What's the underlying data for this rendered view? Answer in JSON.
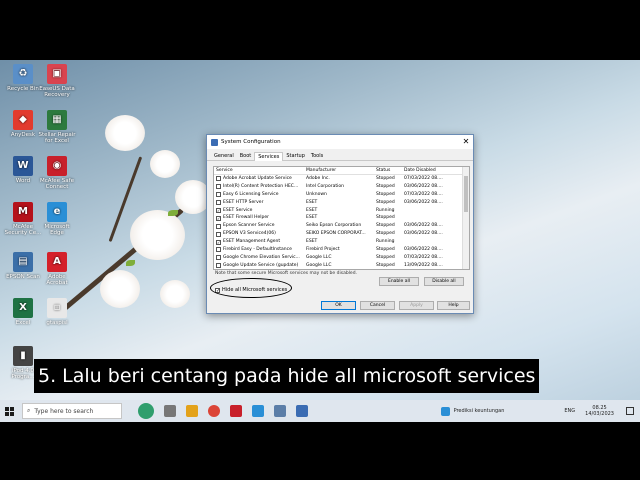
{
  "desktop": {
    "icons": [
      {
        "label": "Recycle Bin",
        "color": "#5a8fc8",
        "glyph": "♻"
      },
      {
        "label": "EaseUS Data Recovery",
        "color": "#d9444f",
        "glyph": "▣"
      },
      {
        "label": "AnyDesk",
        "color": "#e23b2e",
        "glyph": "◆"
      },
      {
        "label": "Stellar Repair for Excel",
        "color": "#2d7a3e",
        "glyph": "▦"
      },
      {
        "label": "Word",
        "color": "#2b5797",
        "glyph": "W"
      },
      {
        "label": "McAfee Safe Connect",
        "color": "#c8202b",
        "glyph": "◉"
      },
      {
        "label": "McAfee Security Ce...",
        "color": "#b5121b",
        "glyph": "M"
      },
      {
        "label": "Microsoft Edge",
        "color": "#2a8fd6",
        "glyph": "e"
      },
      {
        "label": "EPSON Scan",
        "color": "#3b6fa8",
        "glyph": "▤"
      },
      {
        "label": "Adobe Acrobat",
        "color": "#d4202a",
        "glyph": "A"
      },
      {
        "label": "Excel",
        "color": "#1f7244",
        "glyph": "X"
      },
      {
        "label": "gtaspisl",
        "color": "#e8e8e8",
        "glyph": "▫"
      },
      {
        "label": "iPod 4.0 Progra...",
        "color": "#444444",
        "glyph": "▮"
      }
    ]
  },
  "dialog": {
    "title": "System Configuration",
    "close_glyph": "✕",
    "tabs": [
      "General",
      "Boot",
      "Services",
      "Startup",
      "Tools"
    ],
    "active_tab": "Services",
    "columns": [
      "Service",
      "Manufacturer",
      "Status",
      "Date Disabled"
    ],
    "rows": [
      {
        "checked": false,
        "service": "Adobe Acrobat Update Service",
        "manufacturer": "Adobe Inc.",
        "status": "Stopped",
        "date": "07/03/2022 08...."
      },
      {
        "checked": false,
        "service": "Intel(R) Content Protection HEC...",
        "manufacturer": "Intel Corporation",
        "status": "Stopped",
        "date": "03/06/2022 08...."
      },
      {
        "checked": false,
        "service": "Easy 6 Licensing Service",
        "manufacturer": "Unknown",
        "status": "Stopped",
        "date": "07/03/2022 08...."
      },
      {
        "checked": false,
        "service": "ESET HTTP Server",
        "manufacturer": "ESET",
        "status": "Stopped",
        "date": "03/06/2022 08...."
      },
      {
        "checked": true,
        "service": "ESET Service",
        "manufacturer": "ESET",
        "status": "Running",
        "date": ""
      },
      {
        "checked": true,
        "service": "ESET Firewall Helper",
        "manufacturer": "ESET",
        "status": "Stopped",
        "date": ""
      },
      {
        "checked": false,
        "service": "Epson Scanner Service",
        "manufacturer": "Seiko Epson Corporation",
        "status": "Stopped",
        "date": "03/06/2022 08...."
      },
      {
        "checked": false,
        "service": "EPSON V3 Service4(06)",
        "manufacturer": "SEIKO EPSON CORPORAT...",
        "status": "Stopped",
        "date": "03/06/2022 08...."
      },
      {
        "checked": true,
        "service": "ESET Management Agent",
        "manufacturer": "ESET",
        "status": "Running",
        "date": ""
      },
      {
        "checked": false,
        "service": "Firebird Easy - DefaultInstance",
        "manufacturer": "Firebird Project",
        "status": "Stopped",
        "date": "03/06/2022 08...."
      },
      {
        "checked": false,
        "service": "Google Chrome Elevation Servic...",
        "manufacturer": "Google LLC",
        "status": "Stopped",
        "date": "07/03/2022 08...."
      },
      {
        "checked": false,
        "service": "Google Update Service (gupdate)",
        "manufacturer": "Google LLC",
        "status": "Stopped",
        "date": "13/09/2022 08...."
      }
    ],
    "note": "Note that some secure Microsoft services may not be disabled.",
    "enable_all": "Enable all",
    "disable_all": "Disable all",
    "hide_ms_label": "Hide all Microsoft services",
    "hide_ms_checked": true,
    "ok": "OK",
    "cancel": "Cancel",
    "apply": "Apply",
    "help": "Help"
  },
  "caption": "5. Lalu beri centang pada hide all microsoft services",
  "taskbar": {
    "search_placeholder": "Type here to search",
    "weather": "Prediksi keuntungan",
    "lang": "ENG",
    "time": "08.25",
    "date": "14/03/2023"
  }
}
